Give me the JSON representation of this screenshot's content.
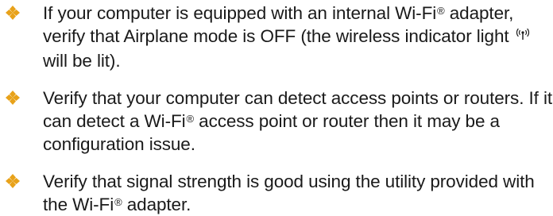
{
  "colors": {
    "bullet": "#e8a21a",
    "text": "#1a1a1a"
  },
  "icons": {
    "bullet": "diamond-bullet-icon",
    "wireless_indicator": "wireless-indicator-icon"
  },
  "items": [
    {
      "a": "If your computer is equipped with an internal Wi-Fi",
      "reg": "®",
      "b": " adapter, verify that Airplane mode is OFF (the wireless indicator light",
      "c": " will be lit)."
    },
    {
      "a": "Verify that your computer can detect access points or routers. If it can detect a Wi-Fi",
      "reg": "®",
      "b": " access point or router then it may be a configuration issue."
    },
    {
      "a": "Verify that signal strength is good using the utility provided with the Wi-Fi",
      "reg": "®",
      "b": " adapter."
    }
  ]
}
